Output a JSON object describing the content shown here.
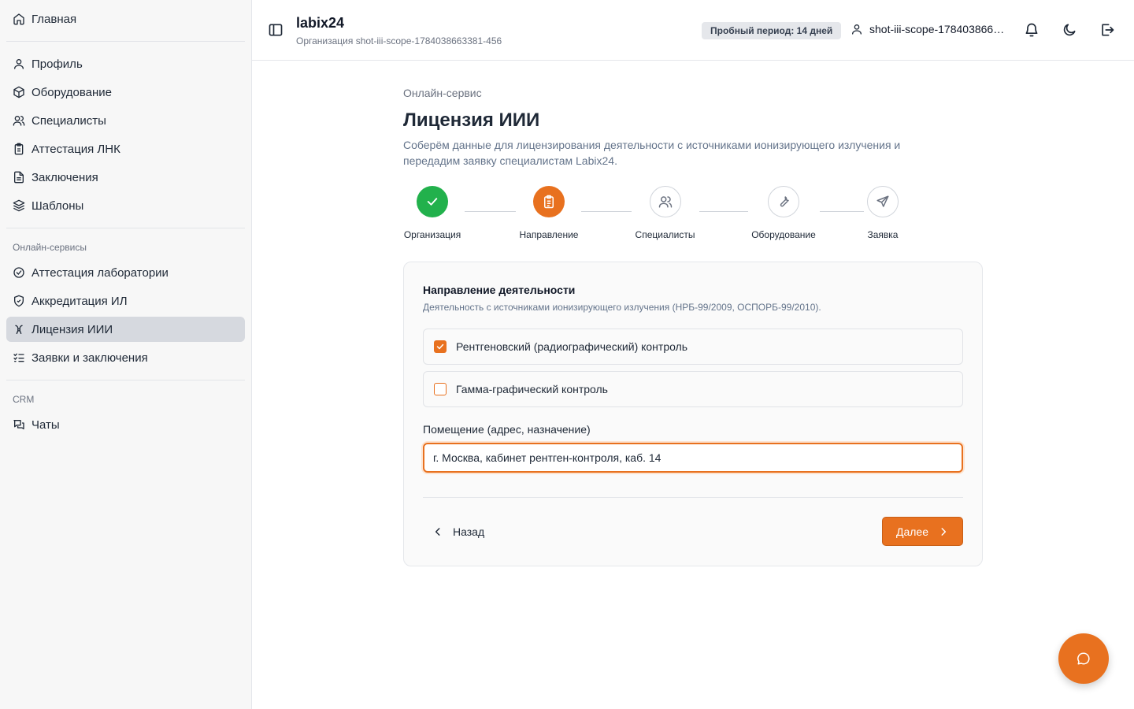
{
  "sidebar": {
    "home": "Главная",
    "items": [
      {
        "label": "Профиль",
        "icon": "user-icon"
      },
      {
        "label": "Оборудование",
        "icon": "box-icon"
      },
      {
        "label": "Специалисты",
        "icon": "users-icon"
      },
      {
        "label": "Аттестация ЛНК",
        "icon": "clipboard-icon"
      },
      {
        "label": "Заключения",
        "icon": "file-text-icon"
      },
      {
        "label": "Шаблоны",
        "icon": "layers-icon"
      }
    ],
    "online_group": "Онлайн-сервисы",
    "online_items": [
      {
        "label": "Аттестация лаборатории",
        "icon": "check-circle-icon"
      },
      {
        "label": "Аккредитация ИЛ",
        "icon": "shield-check-icon"
      },
      {
        "label": "Лицензия ИИИ",
        "icon": "radiation-icon",
        "active": true
      },
      {
        "label": "Заявки и заключения",
        "icon": "list-checks-icon"
      }
    ],
    "crm_group": "CRM",
    "crm_items": [
      {
        "label": "Чаты",
        "icon": "messages-icon"
      }
    ]
  },
  "header": {
    "brand": "labix24",
    "org": "Организация shot-iii-scope-1784038663381-456",
    "trial": "Пробный период: 14 дней",
    "user": "shot-iii-scope-1784038663381-456"
  },
  "page": {
    "eyebrow": "Онлайн-сервис",
    "title": "Лицензия ИИИ",
    "description": "Соберём данные для лицензирования деятельности с источниками ионизирующего излучения и передадим заявку специалистам Labix24."
  },
  "steps": [
    {
      "label": "Организация",
      "status": "done"
    },
    {
      "label": "Направление",
      "status": "current"
    },
    {
      "label": "Специалисты",
      "status": "todo"
    },
    {
      "label": "Оборудование",
      "status": "todo"
    },
    {
      "label": "Заявка",
      "status": "todo"
    }
  ],
  "form": {
    "section_title": "Направление деятельности",
    "section_desc": "Деятельность с источниками ионизирующего излучения (НРБ-99/2009, ОСПОРБ-99/2010).",
    "options": [
      {
        "label": "Рентгеновский (радиографический) контроль",
        "checked": true
      },
      {
        "label": "Гамма-графический контроль",
        "checked": false
      }
    ],
    "room_label": "Помещение (адрес, назначение)",
    "room_value": "г. Москва, кабинет рентген-контроля, каб. 14",
    "back": "Назад",
    "next": "Далее"
  },
  "colors": {
    "accent": "#e8711f",
    "success": "#22b14c",
    "active_nav": "#d6d9df"
  }
}
